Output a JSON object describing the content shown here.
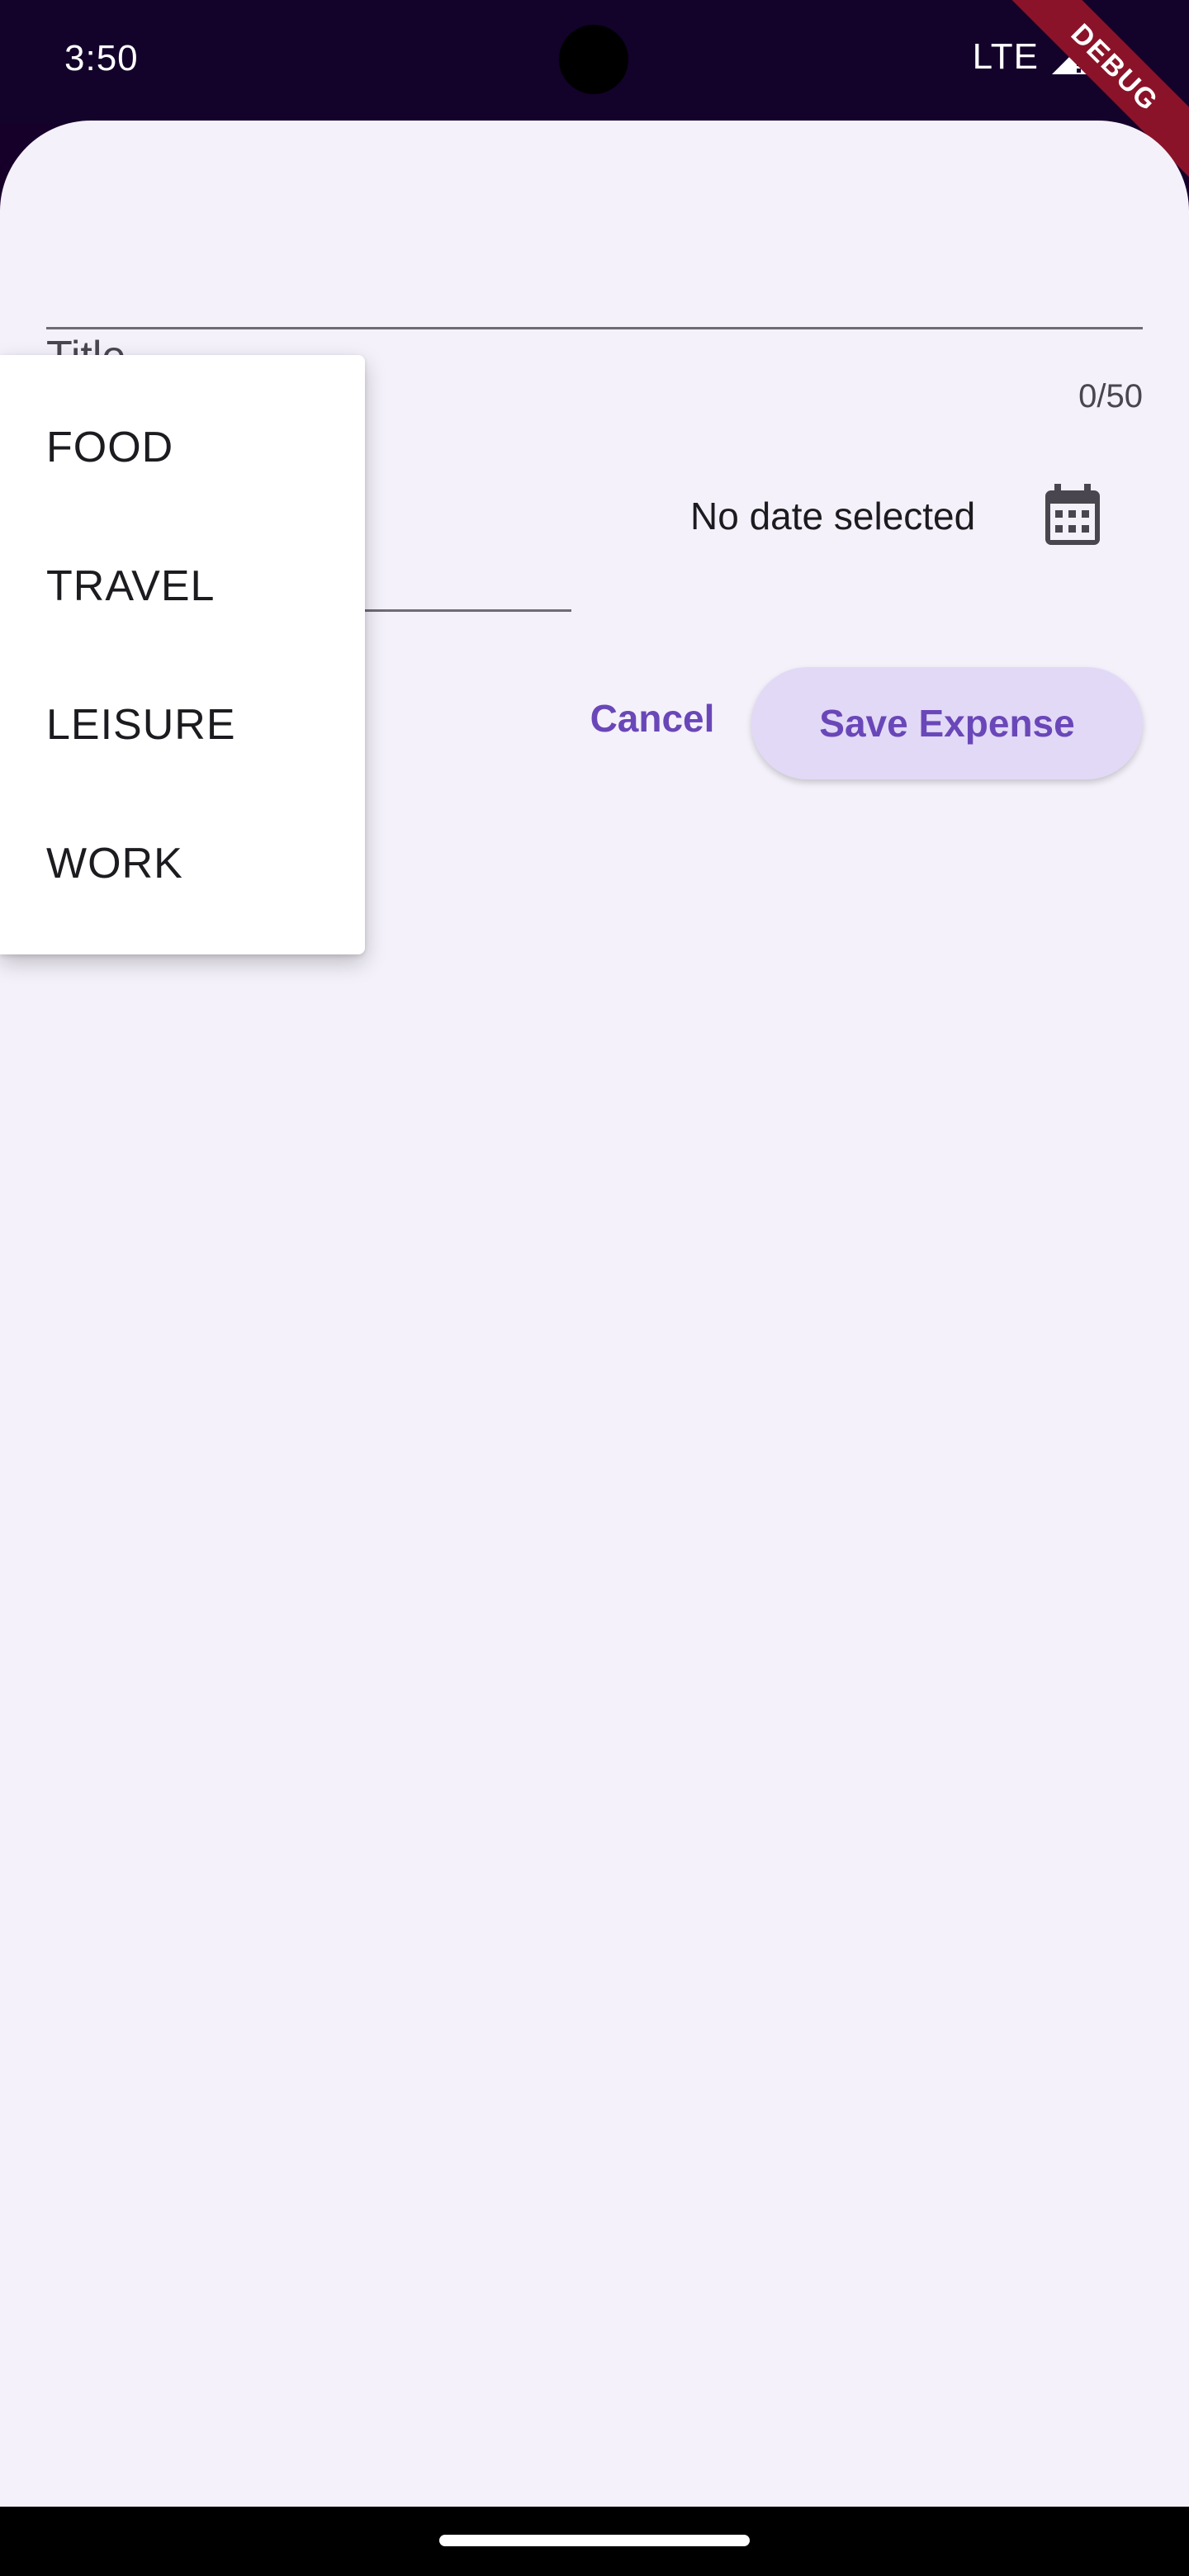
{
  "status_bar": {
    "time": "3:50",
    "network": "LTE"
  },
  "debug_banner": "DEBUG",
  "form": {
    "title_label": "Title",
    "title_counter": "0/50",
    "date_text": "No date selected",
    "cancel_label": "Cancel",
    "save_label": "Save Expense"
  },
  "category_dropdown": {
    "items": [
      "FOOD",
      "TRAVEL",
      "LEISURE",
      "WORK"
    ]
  },
  "colors": {
    "primary": "#6a47b8",
    "button_bg": "#e2d9f7",
    "sheet_bg": "#f4f1fa",
    "status_bar_bg": "#13022a",
    "debug_ribbon": "#8b1329"
  },
  "icons": [
    "signal-icon",
    "battery-icon",
    "calendar-icon"
  ]
}
